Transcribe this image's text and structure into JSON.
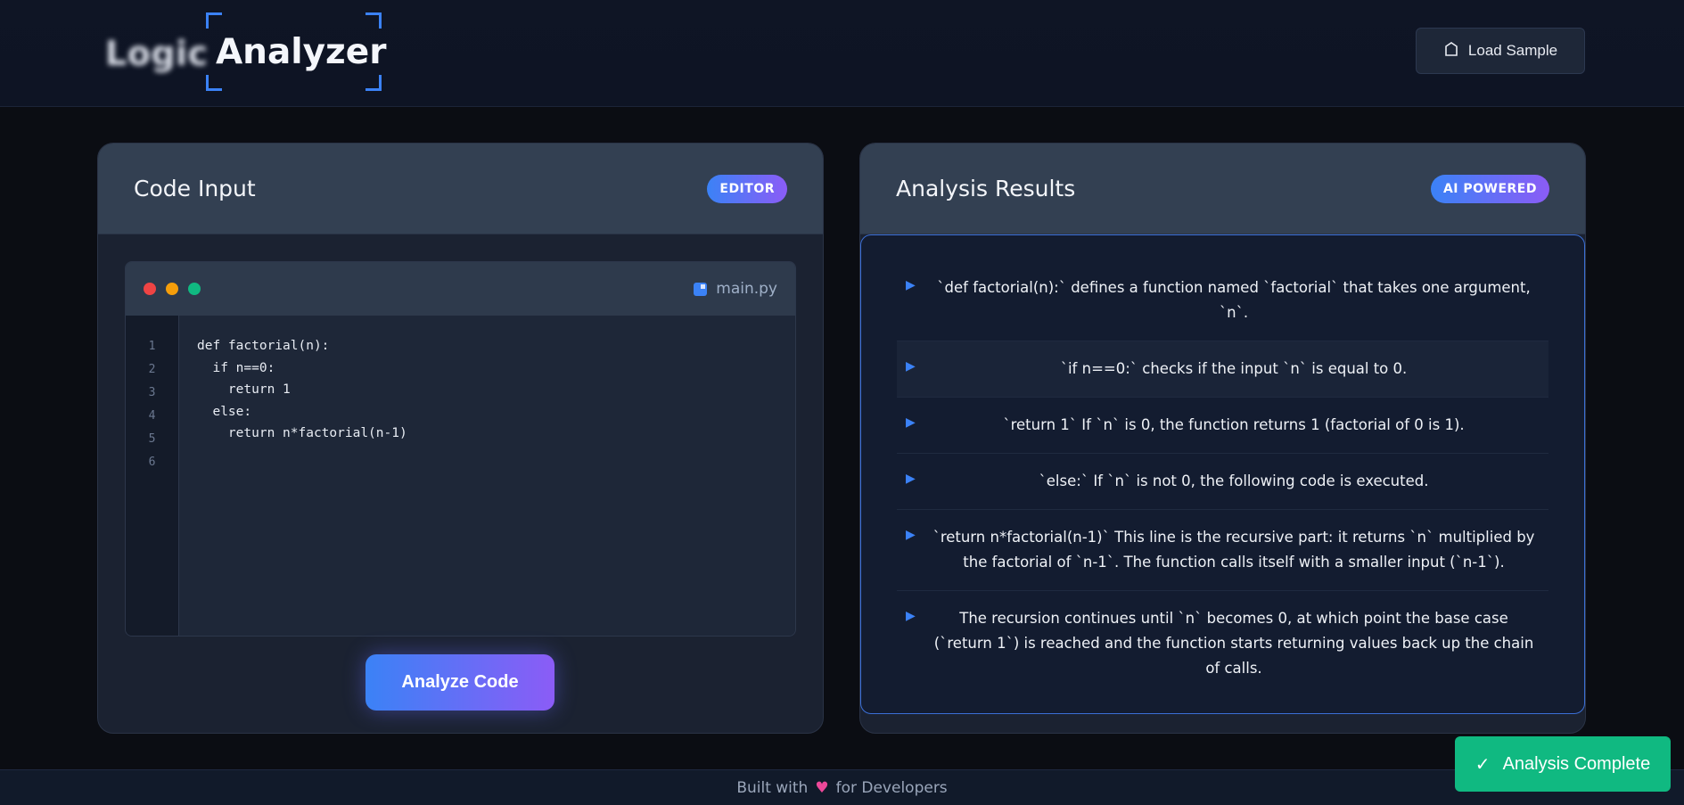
{
  "header": {
    "logo_word1": "Logic",
    "logo_word2": "Analyzer",
    "load_sample_label": "Load Sample"
  },
  "code_panel": {
    "title": "Code Input",
    "badge": "EDITOR",
    "filename": "main.py",
    "line_numbers": [
      "1",
      "2",
      "3",
      "4",
      "5",
      "6"
    ],
    "code_lines": [
      "def factorial(n):",
      "  if n==0:",
      "    return 1",
      "  else:",
      "    return n*factorial(n-1)",
      ""
    ],
    "analyze_label": "Analyze Code"
  },
  "results_panel": {
    "title": "Analysis Results",
    "badge": "AI POWERED",
    "items": [
      "`def factorial(n):` defines a function named `factorial` that takes one argument, `n`.",
      "`if n==0:` checks if the input `n` is equal to 0.",
      "`return 1` If `n` is 0, the function returns 1 (factorial of 0 is 1).",
      "`else:` If `n` is not 0, the following code is executed.",
      "`return n*factorial(n-1)` This line is the recursive part: it returns `n` multiplied by the factorial of `n-1`. The function calls itself with a smaller input (`n-1`).",
      "The recursion continues until `n` becomes 0, at which point the base case (`return 1`) is reached and the function starts returning values back up the chain of calls."
    ],
    "arrow_glyph": "▶"
  },
  "footer": {
    "prefix": "Built with",
    "heart": "♥",
    "suffix": "for Developers"
  },
  "toast": {
    "check": "✓",
    "label": "Analysis Complete"
  },
  "colors": {
    "accent_blue": "#3b82f6",
    "accent_purple": "#8b5cf6",
    "success": "#10b981"
  }
}
